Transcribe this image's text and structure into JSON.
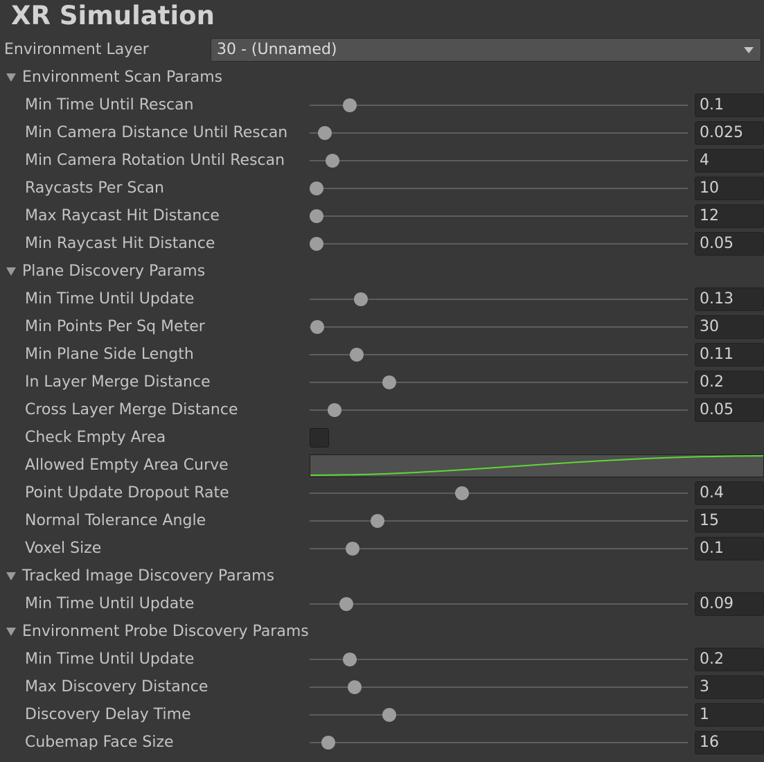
{
  "title": "XR Simulation",
  "environment_layer": {
    "label": "Environment Layer",
    "value": "30 - (Unnamed)"
  },
  "colors": {
    "curve": "#5fd835",
    "background": "#383838",
    "field": "#2a2a2a"
  },
  "curve": {
    "label": "Allowed Empty Area Curve",
    "shape": "ease-in-out rising curve"
  },
  "sections": [
    {
      "title": "Environment Scan Params",
      "rows": [
        {
          "label": "Min Time Until Rescan",
          "type": "slider",
          "value": "0.1",
          "fraction": 0.107
        },
        {
          "label": "Min Camera Distance Until Rescan",
          "type": "slider",
          "value": "0.025",
          "fraction": 0.04
        },
        {
          "label": "Min Camera Rotation Until Rescan",
          "type": "slider",
          "value": "4",
          "fraction": 0.06
        },
        {
          "label": "Raycasts Per Scan",
          "type": "slider",
          "value": "10",
          "fraction": 0.018
        },
        {
          "label": "Max Raycast Hit Distance",
          "type": "slider",
          "value": "12",
          "fraction": 0.018
        },
        {
          "label": "Min Raycast Hit Distance",
          "type": "slider",
          "value": "0.05",
          "fraction": 0.018
        }
      ]
    },
    {
      "title": "Plane Discovery Params",
      "rows": [
        {
          "label": "Min Time Until Update",
          "type": "slider",
          "value": "0.13",
          "fraction": 0.136
        },
        {
          "label": "Min Points Per Sq Meter",
          "type": "slider",
          "value": "30",
          "fraction": 0.02
        },
        {
          "label": "Min Plane Side Length",
          "type": "slider",
          "value": "0.11",
          "fraction": 0.124
        },
        {
          "label": "In Layer Merge Distance",
          "type": "slider",
          "value": "0.2",
          "fraction": 0.21
        },
        {
          "label": "Cross Layer Merge Distance",
          "type": "slider",
          "value": "0.05",
          "fraction": 0.066
        },
        {
          "label": "Check Empty Area",
          "type": "checkbox",
          "checked": false
        },
        {
          "label": "Allowed Empty Area Curve",
          "type": "curve"
        },
        {
          "label": "Point Update Dropout Rate",
          "type": "slider",
          "value": "0.4",
          "fraction": 0.403
        },
        {
          "label": "Normal Tolerance Angle",
          "type": "slider",
          "value": "15",
          "fraction": 0.179
        },
        {
          "label": "Voxel Size",
          "type": "slider",
          "value": "0.1",
          "fraction": 0.113
        }
      ]
    },
    {
      "title": "Tracked Image Discovery Params",
      "rows": [
        {
          "label": "Min Time Until Update",
          "type": "slider",
          "value": "0.09",
          "fraction": 0.097
        }
      ]
    },
    {
      "title": "Environment Probe Discovery Params",
      "rows": [
        {
          "label": "Min Time Until Update",
          "type": "slider",
          "value": "0.2",
          "fraction": 0.107
        },
        {
          "label": "Max Discovery Distance",
          "type": "slider",
          "value": "3",
          "fraction": 0.119
        },
        {
          "label": "Discovery Delay Time",
          "type": "slider",
          "value": "1",
          "fraction": 0.21
        },
        {
          "label": "Cubemap Face Size",
          "type": "slider",
          "value": "16",
          "fraction": 0.049
        }
      ]
    }
  ]
}
